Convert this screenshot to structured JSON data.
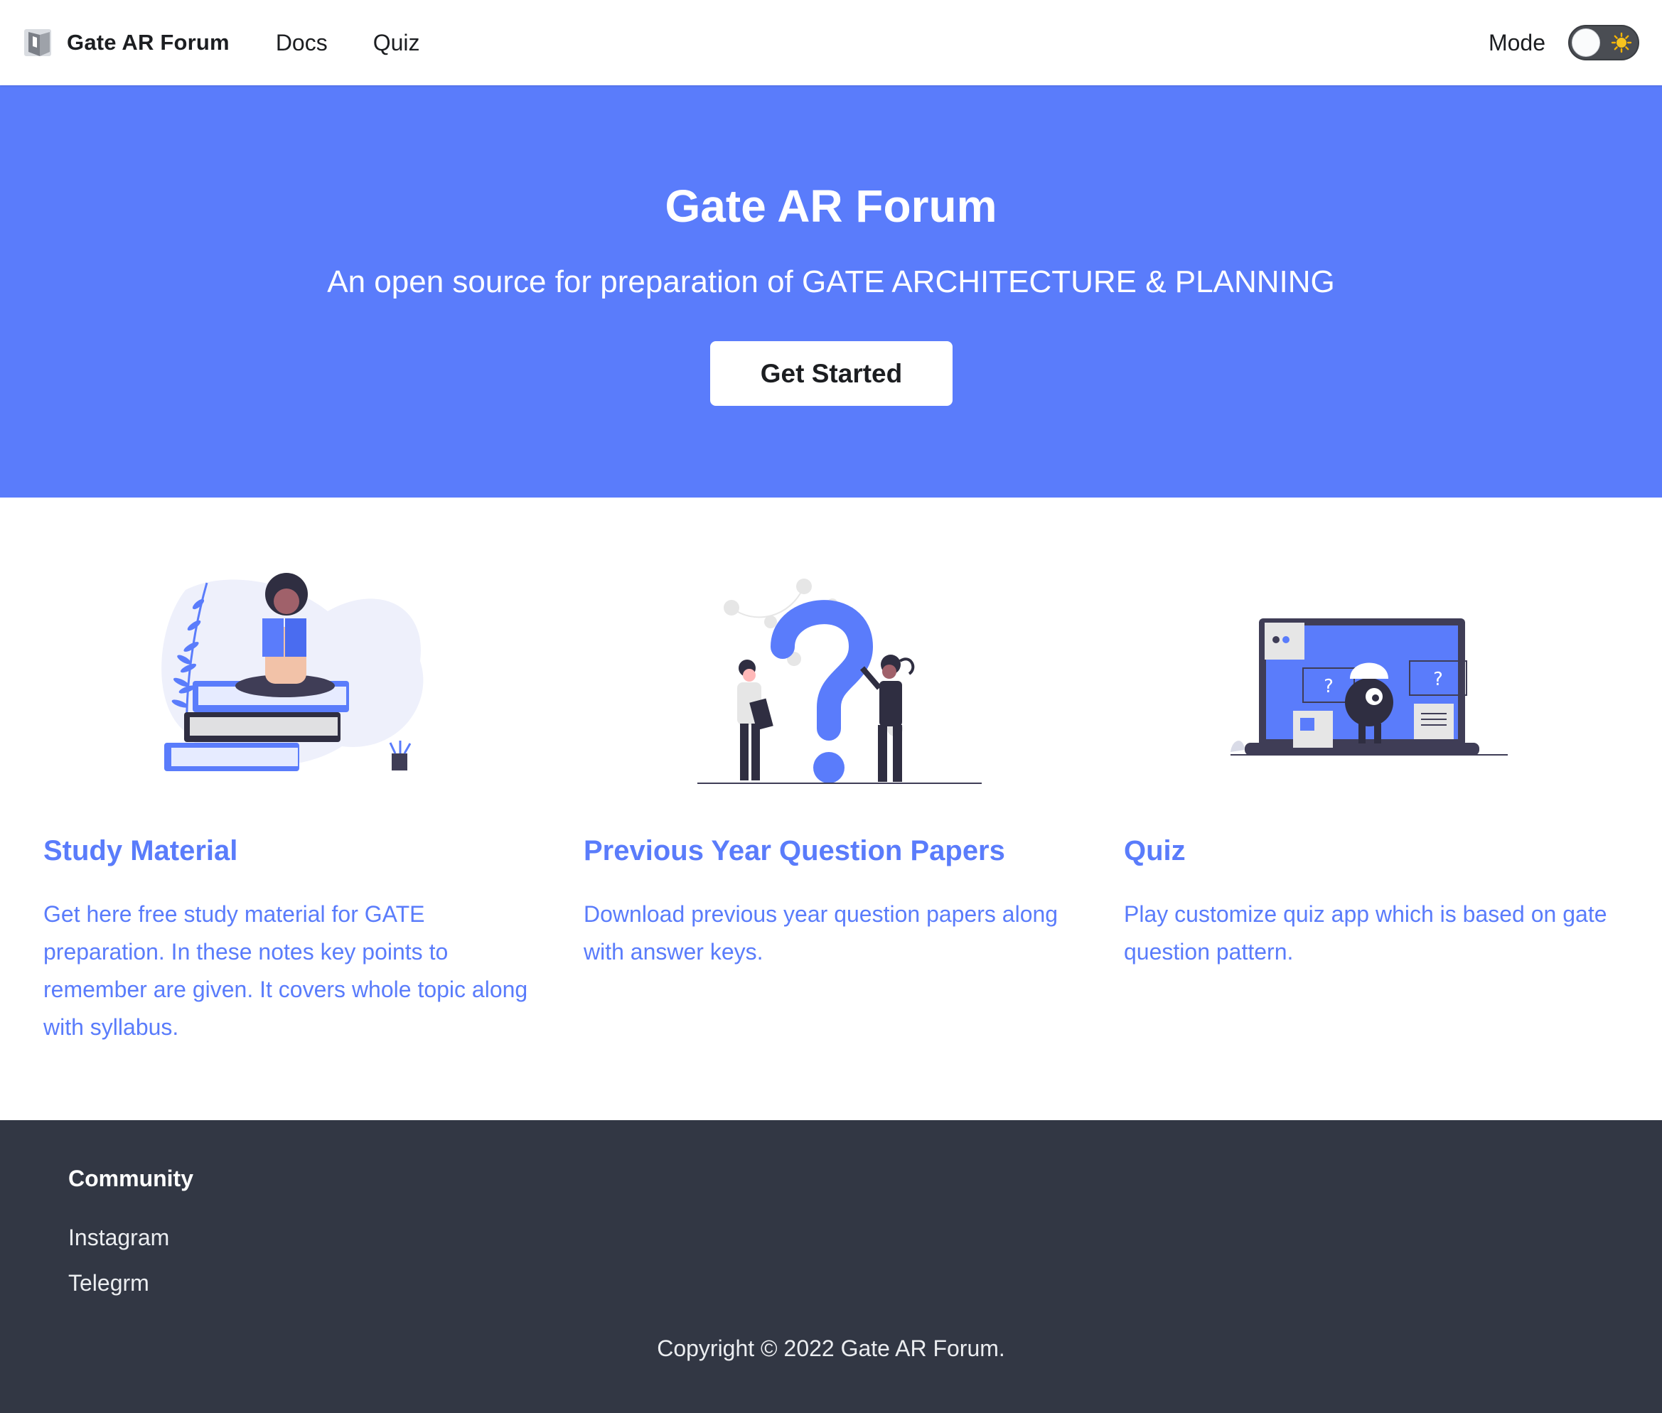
{
  "navbar": {
    "brand_title": "Gate AR Forum",
    "logo_icon": "book-logo-icon",
    "links": [
      {
        "label": "Docs"
      },
      {
        "label": "Quiz"
      }
    ],
    "mode_label": "Mode",
    "mode_toggle": {
      "state": "light",
      "icon": "sun-icon"
    }
  },
  "hero": {
    "title": "Gate AR Forum",
    "subtitle": "An open source for preparation of GATE ARCHITECTURE & PLANNING",
    "button_label": "Get Started"
  },
  "features": [
    {
      "title": "Study Material",
      "text": "Get here free study material for GATE preparation. In these notes key points to remember are given. It covers whole topic along with syllabus.",
      "illustration": "woman-reading-on-books-illustration"
    },
    {
      "title": "Previous Year Question Papers",
      "text": "Download previous year question papers along with answer keys.",
      "illustration": "question-mark-people-illustration"
    },
    {
      "title": "Quiz",
      "text": "Play customize quiz app which is based on gate question pattern.",
      "illustration": "laptop-quiz-illustration"
    }
  ],
  "footer": {
    "heading": "Community",
    "links": [
      {
        "label": "Instagram"
      },
      {
        "label": "Telegrm"
      }
    ],
    "copyright": "Copyright © 2022 Gate AR Forum."
  },
  "colors": {
    "primary": "#5a7cfb",
    "footer_bg": "#323744",
    "navbar_bg": "#ffffff",
    "text_dark": "#1c1e21"
  }
}
